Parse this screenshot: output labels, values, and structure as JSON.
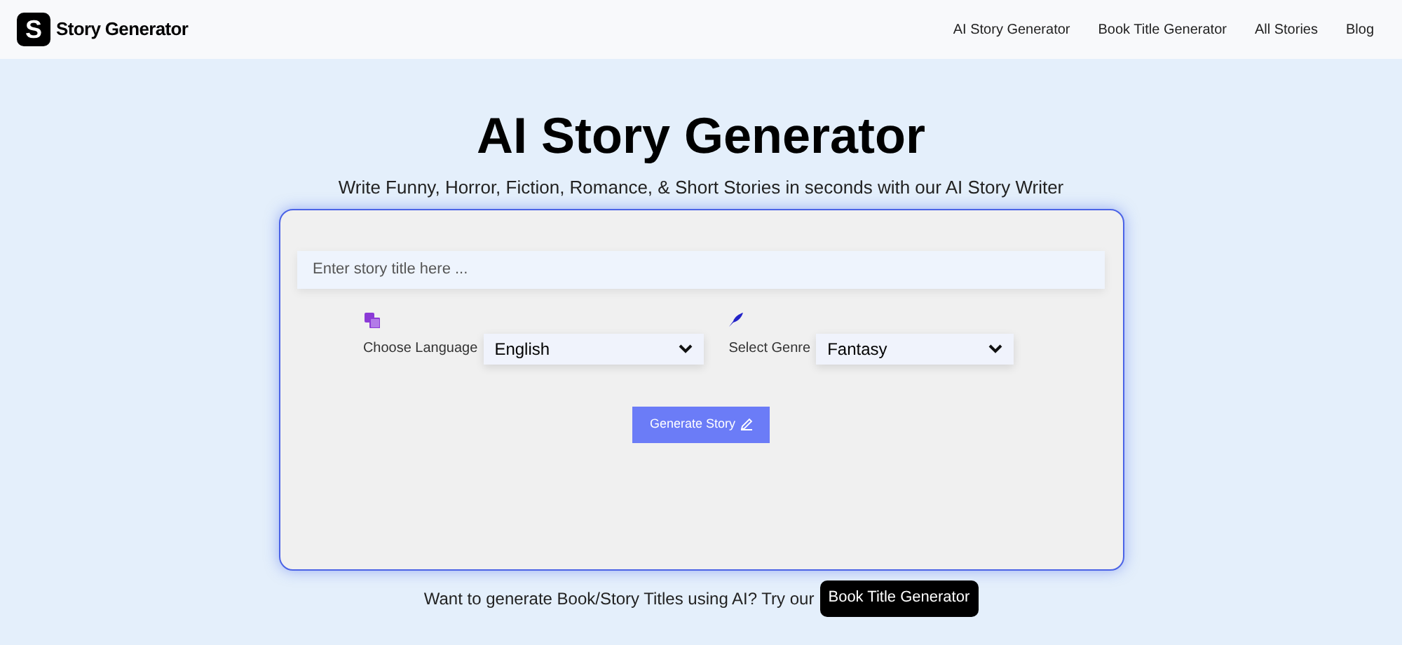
{
  "header": {
    "logo_letter": "S",
    "brand": "Story Generator",
    "nav": [
      "AI Story Generator",
      "Book Title Generator",
      "All Stories",
      "Blog"
    ]
  },
  "hero": {
    "title": "AI Story Generator",
    "subtitle": "Write Funny, Horror, Fiction, Romance, & Short Stories in seconds with our AI Story Writer"
  },
  "form": {
    "title_field": {
      "placeholder": "Enter story title here ..."
    },
    "language": {
      "label": "Choose Language",
      "value": "English"
    },
    "genre": {
      "label": "Select Genre",
      "value": "Fantasy"
    },
    "button": "Generate Story"
  },
  "footer": {
    "text": "Want to generate Book/Story Titles using AI? Try our",
    "button": "Book Title Generator"
  }
}
